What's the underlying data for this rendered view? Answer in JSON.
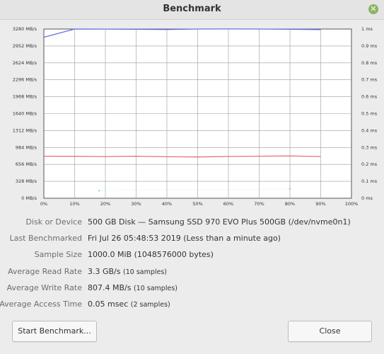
{
  "window": {
    "title": "Benchmark",
    "close_glyph": "✕"
  },
  "chart_data": {
    "type": "line",
    "x": [
      0,
      10,
      20,
      30,
      40,
      50,
      60,
      70,
      80,
      90
    ],
    "x_ticks": [
      "0%",
      "10%",
      "20%",
      "30%",
      "40%",
      "50%",
      "60%",
      "70%",
      "80%",
      "90%",
      "100%"
    ],
    "y_left_ticks": [
      "0 MB/s",
      "328 MB/s",
      "656 MB/s",
      "984 MB/s",
      "1312 MB/s",
      "1640 MB/s",
      "1968 MB/s",
      "2296 MB/s",
      "2624 MB/s",
      "2952 MB/s",
      "3280 MB/s"
    ],
    "y_right_ticks": [
      "0 ms",
      "0.1 ms",
      "0.2 ms",
      "0.3 ms",
      "0.4 ms",
      "0.5 ms",
      "0.6 ms",
      "0.7 ms",
      "0.8 ms",
      "0.9 ms",
      "1 ms"
    ],
    "ylim_left": [
      0,
      3280
    ],
    "ylim_right": [
      0,
      1
    ],
    "xlim": [
      0,
      100
    ],
    "series": [
      {
        "axis": "left",
        "color": "#6b6be6",
        "x": [
          0,
          10,
          20,
          30,
          40,
          50,
          60,
          70,
          80,
          90
        ],
        "values": [
          3120,
          3280,
          3278,
          3276,
          3270,
          3280,
          3282,
          3280,
          3276,
          3268
        ]
      },
      {
        "axis": "left",
        "color": "#e4707e",
        "x": [
          0,
          10,
          20,
          30,
          40,
          50,
          60,
          70,
          80,
          90
        ],
        "values": [
          815,
          812,
          808,
          815,
          805,
          800,
          810,
          815,
          820,
          808
        ]
      },
      {
        "axis": "right",
        "color": "#7ee0a6",
        "style": "points",
        "x": [
          18,
          80
        ],
        "values": [
          0.045,
          0.055
        ]
      }
    ],
    "grid": true
  },
  "info": [
    {
      "label": "Disk or Device",
      "value": "500 GB Disk — Samsung SSD 970 EVO Plus 500GB (/dev/nvme0n1)",
      "note": ""
    },
    {
      "label": "Last Benchmarked",
      "value": "Fri Jul 26 05:48:53 2019 (Less than a minute ago)",
      "note": ""
    },
    {
      "label": "Sample Size",
      "value": "1000.0 MiB (1048576000 bytes)",
      "note": ""
    },
    {
      "label": "Average Read Rate",
      "value": "3.3 GB/s",
      "note": "(10 samples)"
    },
    {
      "label": "Average Write Rate",
      "value": "807.4 MB/s",
      "note": "(10 samples)"
    },
    {
      "label": "Average Access Time",
      "value": "0.05 msec",
      "note": "(2 samples)"
    }
  ],
  "buttons": {
    "start": "Start Benchmark...",
    "close": "Close"
  }
}
